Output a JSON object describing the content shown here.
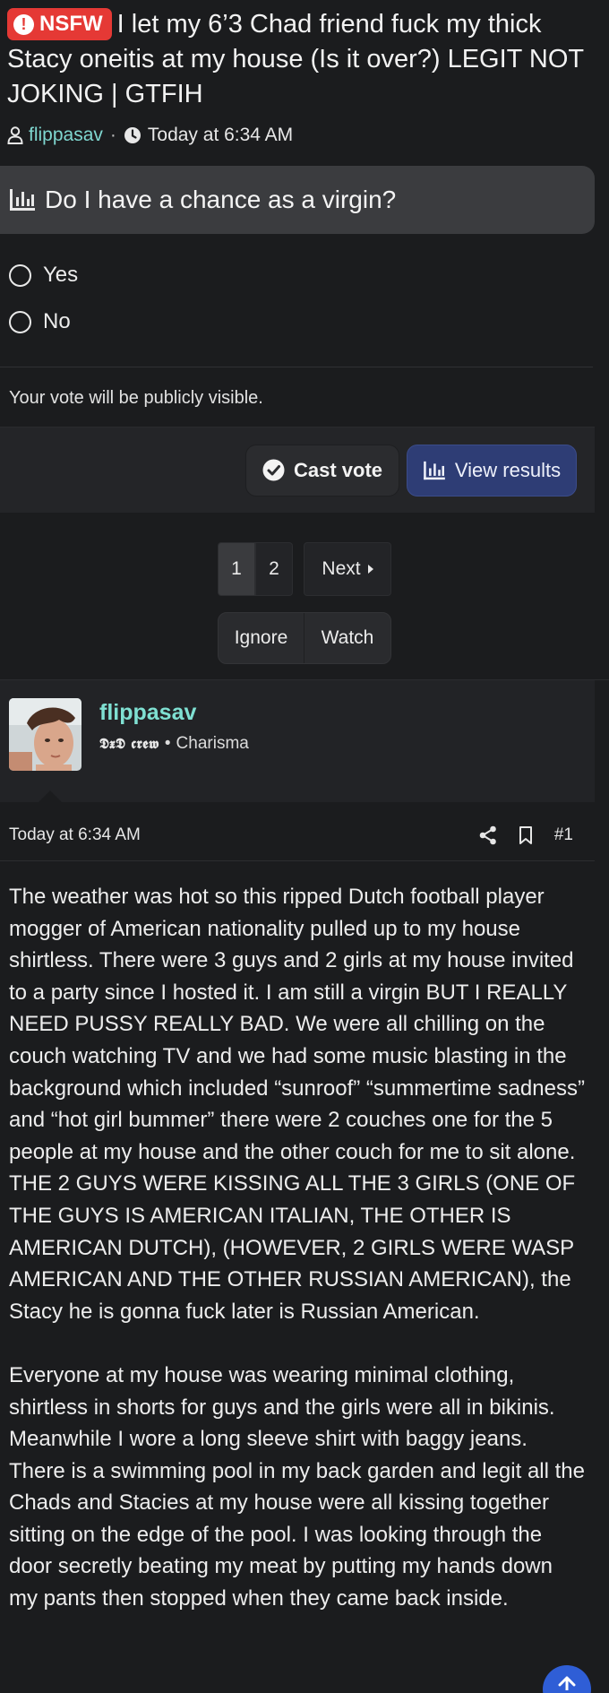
{
  "thread": {
    "nsfw_badge": "NSFW",
    "title": "I let my 6’3 Chad friend fuck my thick Stacy oneitis at my house (Is it over?) LEGIT NOT JOKING | GTFIH",
    "author": "flippasav",
    "separator": "·",
    "timestamp": "Today at 6:34 AM"
  },
  "poll": {
    "question": "Do I have a chance as a virgin?",
    "options": [
      {
        "label": "Yes"
      },
      {
        "label": "No"
      }
    ],
    "note": "Your vote will be publicly visible.",
    "cast_vote_label": "Cast vote",
    "view_results_label": "View results"
  },
  "pagination": {
    "pages": [
      "1",
      "2"
    ],
    "current_page": "1",
    "next_label": "Next"
  },
  "thread_actions": {
    "ignore_label": "Ignore",
    "watch_label": "Watch"
  },
  "post": {
    "author_name": "flippasav",
    "crew": "𝕯𝖝𝕯 𝖈𝖗𝖊𝖜",
    "bullet": "•",
    "user_title": "Charisma",
    "date": "Today at 6:34 AM",
    "number": "#1",
    "paragraphs": [
      "The weather was hot so this ripped Dutch football player mogger of American nationality pulled up to my house shirtless. There were 3 guys and 2 girls at my house invited to a party since I hosted it. I am still a virgin BUT I REALLY NEED PUSSY REALLY BAD. We were all chilling on the couch watching TV and we had some music blasting in the background which included “sunroof” “summertime sadness” and “hot girl bummer” there were 2 couches one for the 5 people at my house and the other couch for me to sit alone. THE 2 GUYS WERE KISSING ALL THE 3 GIRLS (ONE OF THE GUYS IS AMERICAN ITALIAN, THE OTHER IS AMERICAN DUTCH), (HOWEVER, 2 GIRLS WERE WASP AMERICAN AND THE OTHER RUSSIAN AMERICAN), the Stacy he is gonna fuck later is Russian American.",
      "Everyone at my house was wearing minimal clothing, shirtless in shorts for guys and the girls were all in bikinis. Meanwhile I wore a long sleeve shirt with baggy jeans. There is a swimming pool in my back garden and legit all the Chads and Stacies at my house were all kissing together sitting on the edge of the pool. I was looking through the door secretly beating my meat by putting my hands down my pants then stopped when they came back inside."
    ]
  },
  "colors": {
    "background": "#1b1c1e",
    "nsfw_red": "#e53935",
    "username_teal": "#7fe0d2",
    "results_blue": "#2e3d75",
    "scroll_top_blue": "#2f5ed6"
  },
  "icons": [
    "exclamation-circle-icon",
    "user-icon",
    "clock-icon",
    "poll-chart-icon",
    "check-circle-icon",
    "chevron-right-icon",
    "share-icon",
    "bookmark-icon",
    "arrow-up-icon"
  ]
}
